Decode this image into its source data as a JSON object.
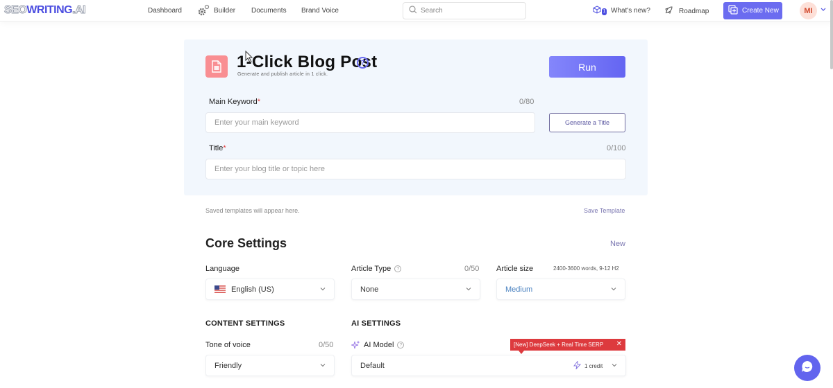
{
  "header": {
    "logo": {
      "seo": "SEO",
      "writing": "WRITING",
      "ai": ".AI"
    },
    "nav": [
      {
        "label": "Dashboard"
      },
      {
        "label": "Builder",
        "icon": "gears-icon"
      },
      {
        "label": "Documents"
      },
      {
        "label": "Brand Voice"
      }
    ],
    "search_placeholder": "Search",
    "whats_new": {
      "label": "What's new?",
      "badge": "1"
    },
    "roadmap": {
      "label": "Roadmap"
    },
    "create_new": {
      "label": "Create New"
    },
    "avatar": {
      "initials": "MI"
    },
    "colors": {
      "brand": "#4b4de0",
      "button": "#6b6cf0"
    }
  },
  "tool": {
    "title": "1-Click Blog Post",
    "subtitle": "Generate and publish article in 1 click.",
    "run_label": "Run",
    "main_keyword": {
      "label": "Main Keyword",
      "required": "*",
      "counter": "0/80",
      "placeholder": "Enter your main keyword",
      "value": ""
    },
    "generate_title_label": "Generate a Title",
    "title_field": {
      "label": "Title",
      "required": "*",
      "counter": "0/100",
      "placeholder": "Enter your blog title or topic here",
      "value": ""
    }
  },
  "templates": {
    "saved_text": "Saved templates will appear here.",
    "save_label": "Save Template"
  },
  "core_settings": {
    "title": "Core Settings",
    "new_label": "New",
    "language": {
      "label": "Language",
      "value": "English (US)"
    },
    "article_type": {
      "label": "Article Type",
      "counter": "0/50",
      "value": "None"
    },
    "article_size": {
      "label": "Article size",
      "hint": "2400-3600 words, 9-12 H2",
      "value": "Medium"
    },
    "content_settings": {
      "heading": "CONTENT SETTINGS",
      "tone": {
        "label": "Tone of voice",
        "counter": "0/50",
        "value": "Friendly"
      }
    },
    "ai_settings": {
      "heading": "AI SETTINGS",
      "model": {
        "label": "AI Model",
        "value": "Default",
        "credit": "1 credit"
      },
      "tooltip": "[New] DeepSeek + Real Time SERP",
      "tooltip_close": "✕"
    }
  },
  "help_glyph": "?"
}
